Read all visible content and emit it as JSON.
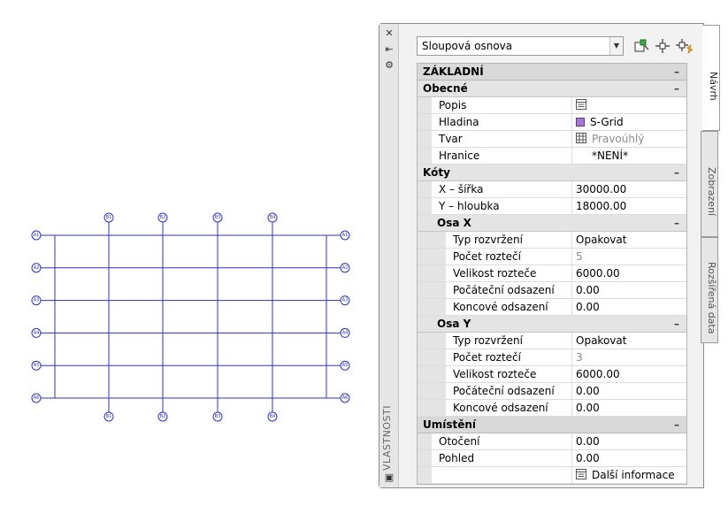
{
  "grid": {
    "colors": {
      "line": "#3030c0",
      "bubble_fill": "#ffffff"
    },
    "rows": [
      "A1",
      "A2",
      "A3",
      "A4",
      "A5",
      "A6"
    ],
    "columns": [
      "B1",
      "B2",
      "B3",
      "B4"
    ]
  },
  "palette": {
    "strip": {
      "close_glyph": "✕",
      "pin_glyph": "⇤",
      "settings_glyph": "⚙",
      "title": "VLASTNOSTI",
      "bottom_glyph": "▣"
    },
    "toolbar": {
      "type_value": "Sloupová osnova",
      "dropdown_glyph": "▼",
      "icons": [
        "quick-select-icon",
        "pick-objects-icon",
        "toggle-pickadd-icon"
      ]
    },
    "rows": [
      {
        "kind": "cat-1",
        "label": "ZÁKLADNÍ",
        "toggle": "–"
      },
      {
        "kind": "cat-2",
        "label": "Obecné",
        "toggle": "–"
      },
      {
        "kind": "prop",
        "level": 1,
        "label": "Popis",
        "value": "",
        "icon": "description-icon"
      },
      {
        "kind": "prop",
        "level": 1,
        "label": "Hladina",
        "value": "S-Grid",
        "icon": "layer-color-swatch"
      },
      {
        "kind": "prop",
        "level": 1,
        "label": "Tvar",
        "value": "Pravoúhlý",
        "icon": "grid-shape-icon",
        "dim": true
      },
      {
        "kind": "prop",
        "level": 1,
        "label": "Hranice",
        "value": "*NENÍ*",
        "indent": true
      },
      {
        "kind": "cat-2",
        "label": "Kóty",
        "toggle": "–"
      },
      {
        "kind": "prop",
        "level": 1,
        "label": "X – šířka",
        "value": "30000.00"
      },
      {
        "kind": "prop",
        "level": 1,
        "label": "Y – hloubka",
        "value": "18000.00"
      },
      {
        "kind": "cat-2",
        "level": 1,
        "label": "Osa X",
        "toggle": "–"
      },
      {
        "kind": "prop",
        "level": 2,
        "label": "Typ rozvržení",
        "value": "Opakovat"
      },
      {
        "kind": "prop",
        "level": 2,
        "label": "Počet roztečí",
        "value": "5",
        "dim": true
      },
      {
        "kind": "prop",
        "level": 2,
        "label": "Velikost rozteče",
        "value": "6000.00"
      },
      {
        "kind": "prop",
        "level": 2,
        "label": "Počáteční odsazení",
        "value": "0.00"
      },
      {
        "kind": "prop",
        "level": 2,
        "label": "Koncové odsazení",
        "value": "0.00"
      },
      {
        "kind": "cat-2",
        "level": 1,
        "label": "Osa Y",
        "toggle": "–"
      },
      {
        "kind": "prop",
        "level": 2,
        "label": "Typ rozvržení",
        "value": "Opakovat"
      },
      {
        "kind": "prop",
        "level": 2,
        "label": "Počet roztečí",
        "value": "3",
        "dim": true
      },
      {
        "kind": "prop",
        "level": 2,
        "label": "Velikost rozteče",
        "value": "6000.00"
      },
      {
        "kind": "prop",
        "level": 2,
        "label": "Počáteční odsazení",
        "value": "0.00"
      },
      {
        "kind": "prop",
        "level": 2,
        "label": "Koncové odsazení",
        "value": "0.00"
      },
      {
        "kind": "cat-1",
        "label": "Umístění",
        "toggle": "–"
      },
      {
        "kind": "prop",
        "level": 1,
        "label": "Otočení",
        "value": "0.00"
      },
      {
        "kind": "prop",
        "level": 1,
        "label": "Pohled",
        "value": "0.00"
      },
      {
        "kind": "prop",
        "level": 1,
        "label": "",
        "value": "Další informace",
        "icon": "description-icon"
      }
    ],
    "tabs": [
      "Návrh",
      "Zobrazení",
      "Rozšířená data"
    ],
    "colors": {
      "layer_swatch": "#a874d9"
    }
  }
}
